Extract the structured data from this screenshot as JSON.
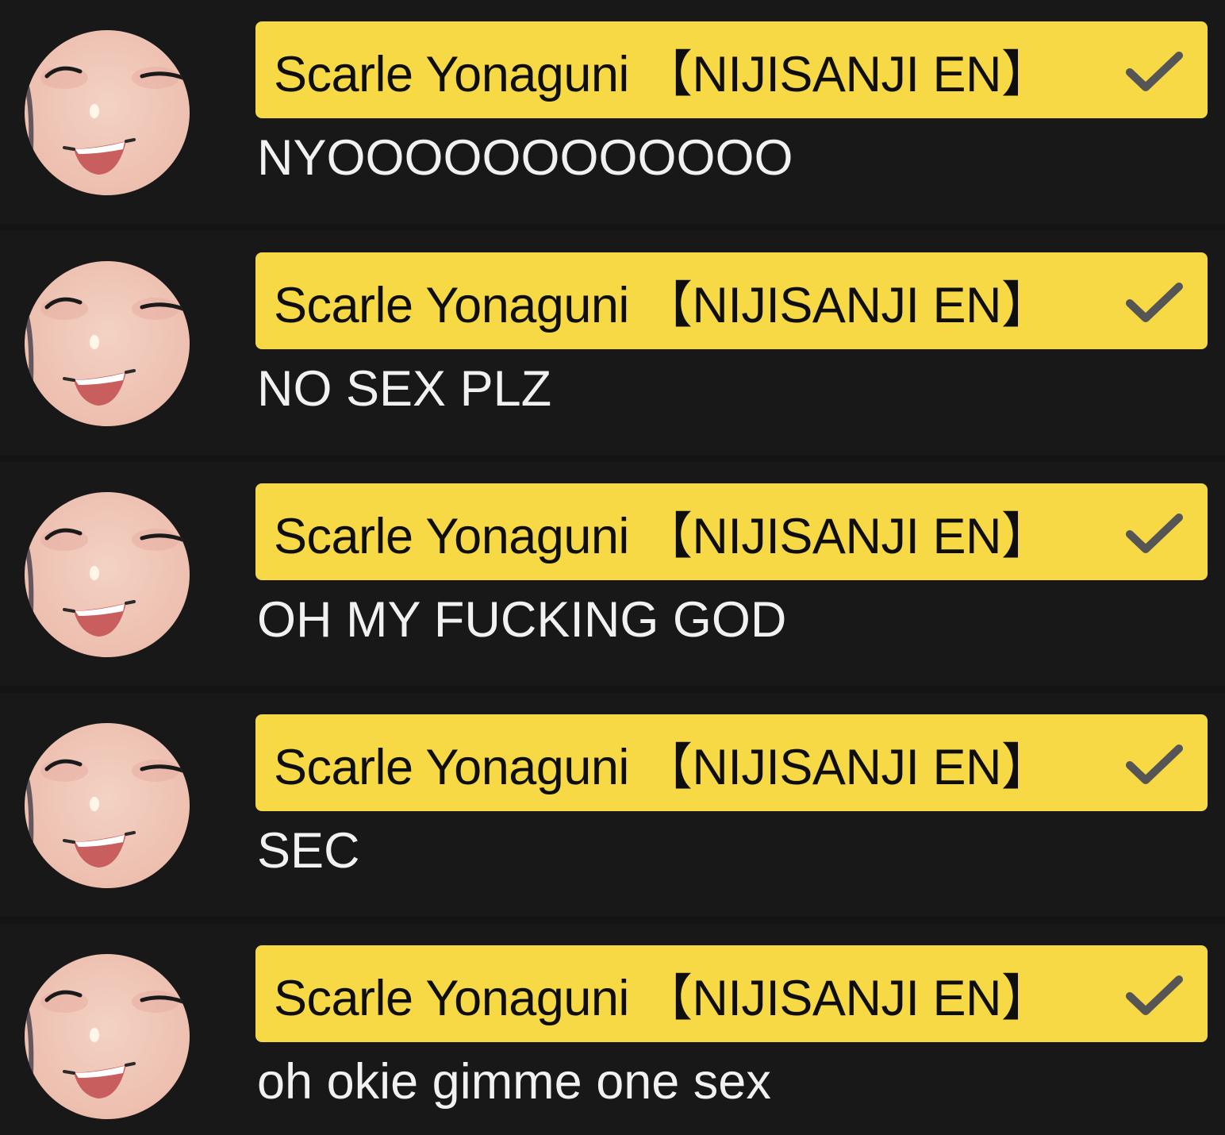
{
  "messages": [
    {
      "author": "Scarle Yonaguni 【NIJISANJI EN】",
      "text": "NYOOOOOOOOOOOO"
    },
    {
      "author": "Scarle Yonaguni 【NIJISANJI EN】",
      "text": "NO SEX PLZ"
    },
    {
      "author": "Scarle Yonaguni 【NIJISANJI EN】",
      "text": "OH MY FUCKING GOD"
    },
    {
      "author": "Scarle Yonaguni 【NIJISANJI EN】",
      "text": "SEC"
    },
    {
      "author": "Scarle Yonaguni 【NIJISANJI EN】",
      "text": "oh okie gimme one sex"
    }
  ],
  "icons": {
    "verified": "checkmark-icon",
    "avatar": "smiling-face-avatar"
  },
  "colors": {
    "background": "#181818",
    "badge": "#f7d845",
    "badge_text": "#0e0e0e",
    "message_text": "#f1f1f1",
    "check": "#555555"
  }
}
